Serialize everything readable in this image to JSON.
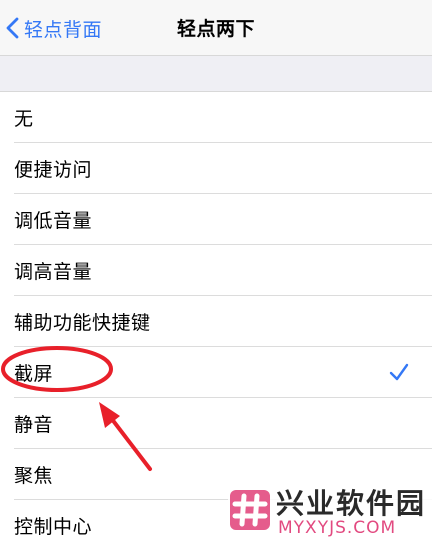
{
  "nav": {
    "back_label": "轻点背面",
    "title": "轻点两下"
  },
  "items": [
    {
      "label": "无",
      "selected": false
    },
    {
      "label": "便捷访问",
      "selected": false
    },
    {
      "label": "调低音量",
      "selected": false
    },
    {
      "label": "调高音量",
      "selected": false
    },
    {
      "label": "辅助功能快捷键",
      "selected": false
    },
    {
      "label": "截屏",
      "selected": true
    },
    {
      "label": "静音",
      "selected": false
    },
    {
      "label": "聚焦",
      "selected": false
    },
    {
      "label": "控制中心",
      "selected": false
    }
  ],
  "watermark": {
    "name": "兴业软件园",
    "domain": "MYXYJS.COM"
  },
  "colors": {
    "accent": "#3478f6",
    "annotation": "#e8202a",
    "watermark_pink": "#e24a80"
  }
}
